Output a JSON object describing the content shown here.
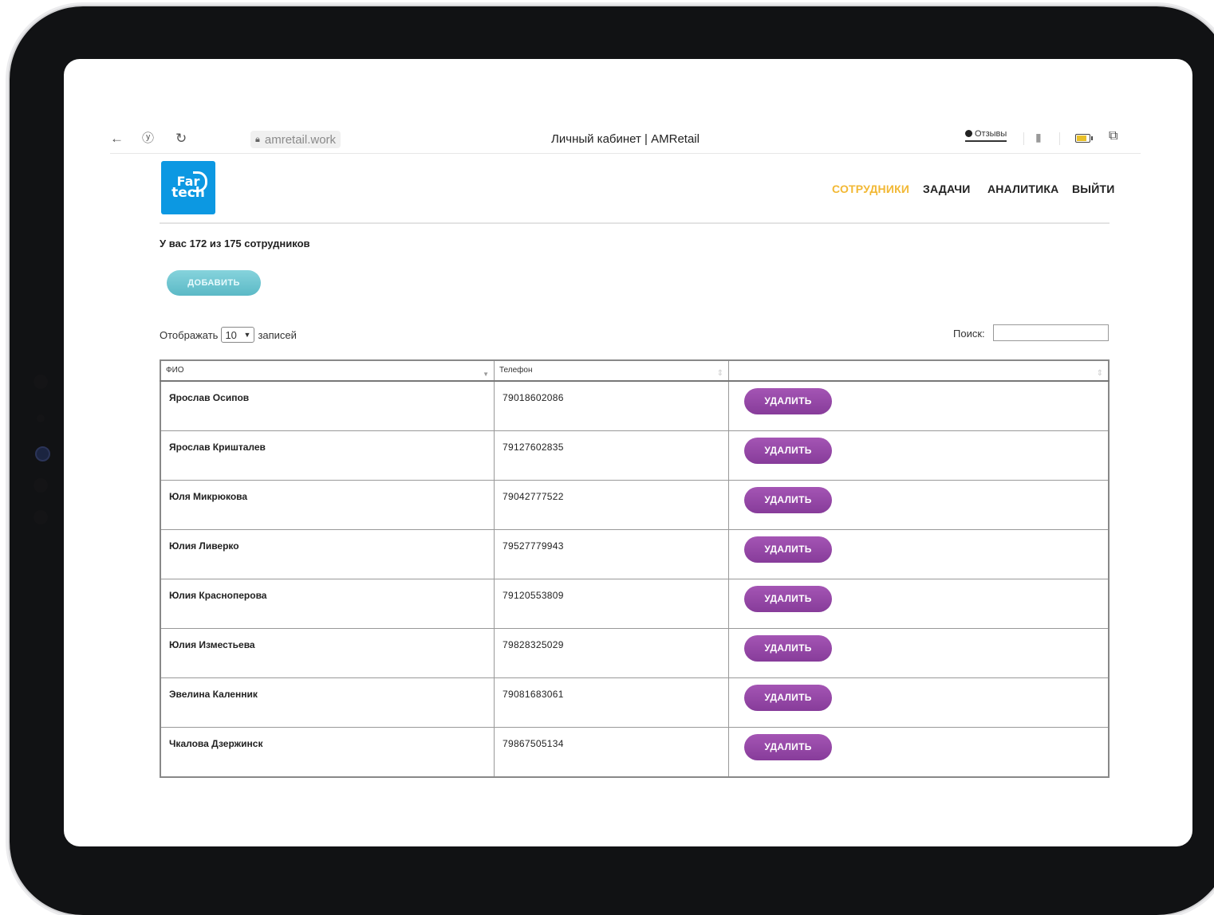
{
  "browser": {
    "url": "amretail.work",
    "title": "Личный кабинет | AMRetail",
    "feedback": "Отзывы"
  },
  "logo": {
    "line1": "Far",
    "line2": "tech"
  },
  "nav": [
    {
      "label": "СОТРУДНИКИ",
      "active": true
    },
    {
      "label": "ЗАДАЧИ",
      "active": false
    },
    {
      "label": "АНАЛИТИКА",
      "active": false
    },
    {
      "label": "ВЫЙТИ",
      "active": false
    }
  ],
  "summary": "У вас 172 из 175 сотрудников",
  "add_button": "ДОБАВИТЬ",
  "length": {
    "prefix": "Отображать",
    "value": "10",
    "suffix": "записей"
  },
  "search": {
    "label": "Поиск:",
    "value": ""
  },
  "table": {
    "columns": [
      "ФИО",
      "Телефон",
      ""
    ],
    "rows": [
      {
        "name": "Ярослав Осипов",
        "phone": "79018602086",
        "action": "УДАЛИТЬ"
      },
      {
        "name": "Ярослав Кришталев",
        "phone": "79127602835",
        "action": "УДАЛИТЬ"
      },
      {
        "name": "Юля Микрюкова",
        "phone": "79042777522",
        "action": "УДАЛИТЬ"
      },
      {
        "name": "Юлия Ливерко",
        "phone": "79527779943",
        "action": "УДАЛИТЬ"
      },
      {
        "name": "Юлия Краснoперова",
        "phone": "79120553809",
        "action": "УДАЛИТЬ"
      },
      {
        "name": "Юлия Изместьева",
        "phone": "79828325029",
        "action": "УДАЛИТЬ"
      },
      {
        "name": "Эвелина Каленник",
        "phone": "79081683061",
        "action": "УДАЛИТЬ"
      },
      {
        "name": "Чкалова Дзержинск",
        "phone": "79867505134",
        "action": "УДАЛИТЬ"
      }
    ]
  },
  "colors": {
    "nav_active": "#f2b834",
    "add_button": "#6cc5d0",
    "delete_button": "#9a4aab",
    "logo_bg": "#0c98e2"
  },
  "icons": [
    "back-arrow-icon",
    "yandex-icon",
    "reload-icon",
    "lock-icon",
    "feedback-bubble-icon",
    "bookmark-icon",
    "battery-icon",
    "extension-icon",
    "sort-desc-icon",
    "sort-icon",
    "chevron-down-icon"
  ]
}
